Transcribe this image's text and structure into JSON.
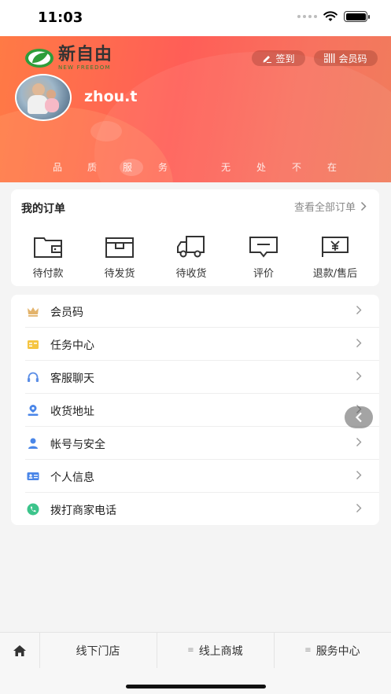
{
  "status": {
    "time": "11:03"
  },
  "brand": {
    "name_cn": "新自由",
    "name_en": "NEW FREEDOM",
    "accent": "#ff5e57",
    "logo_green": "#2e9d3a"
  },
  "header": {
    "sign_label": "签到",
    "member_code_label": "会员码",
    "username": "zhou.t",
    "slogan": [
      "品",
      "质",
      "服",
      "务",
      "无",
      "处",
      "不",
      "在"
    ]
  },
  "orders": {
    "title": "我的订单",
    "view_all": "查看全部订单",
    "items": [
      {
        "label": "待付款",
        "icon": "wallet-icon"
      },
      {
        "label": "待发货",
        "icon": "box-icon"
      },
      {
        "label": "待收货",
        "icon": "truck-icon"
      },
      {
        "label": "评价",
        "icon": "comment-icon"
      },
      {
        "label": "退款/售后",
        "icon": "refund-icon"
      }
    ]
  },
  "menu": [
    {
      "label": "会员码",
      "icon": "crown-icon",
      "color": "#e3b36b"
    },
    {
      "label": "任务中心",
      "icon": "task-icon",
      "color": "#f5c542"
    },
    {
      "label": "客服聊天",
      "icon": "headset-icon",
      "color": "#5b8ee6"
    },
    {
      "label": "收货地址",
      "icon": "location-icon",
      "color": "#4a86e8"
    },
    {
      "label": "帐号与安全",
      "icon": "user-shield-icon",
      "color": "#4a86e8"
    },
    {
      "label": "个人信息",
      "icon": "id-card-icon",
      "color": "#4a86e8"
    },
    {
      "label": "拨打商家电话",
      "icon": "phone-icon",
      "color": "#3cc48b"
    }
  ],
  "bottom_nav": {
    "home_icon": "home-icon",
    "tabs": [
      "线下门店",
      "线上商城",
      "服务中心"
    ]
  }
}
